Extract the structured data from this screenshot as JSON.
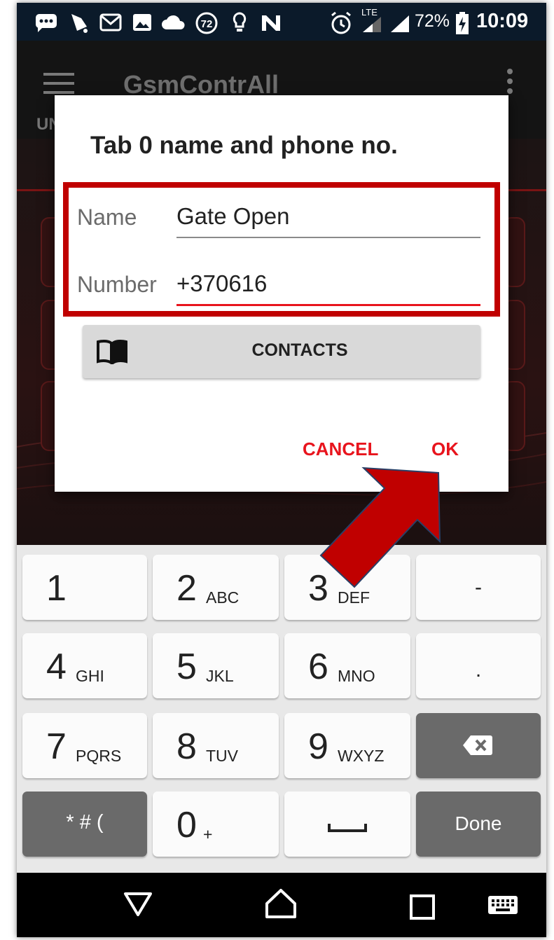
{
  "status_bar": {
    "battery": "72%",
    "time": "10:09",
    "network": "LTE",
    "notification_badge": "72",
    "icons": [
      "chat-icon",
      "bell-icon",
      "gmail-icon",
      "image-icon",
      "cloud-icon",
      "badge-72-icon",
      "bulb-icon",
      "n-icon",
      "alarm-icon",
      "signal-icon",
      "signal-icon",
      "battery-charging-icon"
    ]
  },
  "app_bar": {
    "title": "GsmContrAll",
    "tab_fragment": "UN",
    "menu_icon": "hamburger-icon",
    "overflow_icon": "more-vert-icon"
  },
  "dialog": {
    "title": "Tab 0 name and phone no.",
    "name_label": "Name",
    "name_value": "Gate Open",
    "number_label": "Number",
    "number_value": "+370616",
    "contacts_label": "CONTACTS",
    "contacts_icon": "book-icon",
    "cancel_label": "CANCEL",
    "ok_label": "OK",
    "accent_color": "#e8141d",
    "highlight_color": "#c00000"
  },
  "keyboard": {
    "rows": [
      [
        {
          "main": "1",
          "sub": ""
        },
        {
          "main": "2",
          "sub": "ABC"
        },
        {
          "main": "3",
          "sub": "DEF"
        },
        {
          "main": "-",
          "sub": ""
        }
      ],
      [
        {
          "main": "4",
          "sub": "GHI"
        },
        {
          "main": "5",
          "sub": "JKL"
        },
        {
          "main": "6",
          "sub": "MNO"
        },
        {
          "main": ".",
          "sub": ""
        }
      ],
      [
        {
          "main": "7",
          "sub": "PQRS"
        },
        {
          "main": "8",
          "sub": "TUV"
        },
        {
          "main": "9",
          "sub": "WXYZ"
        },
        {
          "main": "backspace",
          "sub": ""
        }
      ],
      [
        {
          "main": "* # (",
          "sub": ""
        },
        {
          "main": "0",
          "sub": "+"
        },
        {
          "main": "space",
          "sub": ""
        },
        {
          "main": "Done",
          "sub": ""
        }
      ]
    ]
  },
  "nav_bar": {
    "icons": [
      "back-triangle-icon",
      "home-icon",
      "recents-icon",
      "keyboard-icon"
    ]
  },
  "annotation": {
    "arrow_color": "#c00000",
    "arrow_target": "ok-button"
  }
}
